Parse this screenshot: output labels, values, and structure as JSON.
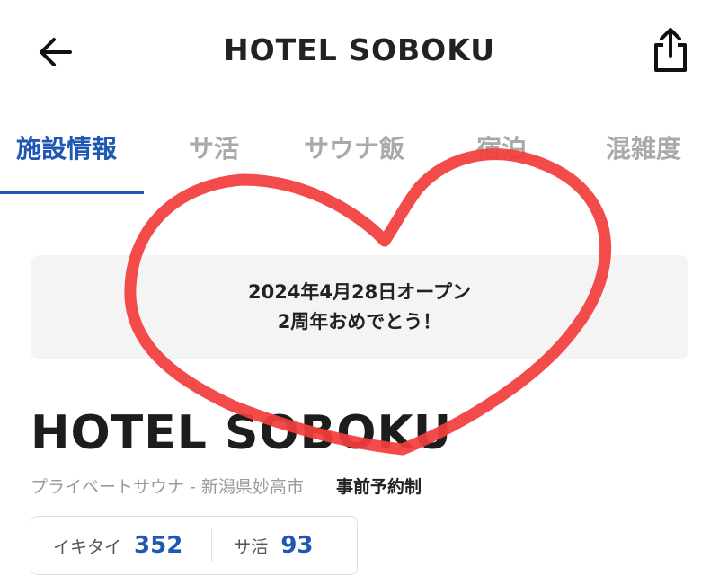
{
  "header": {
    "back_icon": "arrow-left-icon",
    "title": "HOTEL SOBOKU",
    "share_icon": "share-icon"
  },
  "tabs": [
    {
      "label": "施設情報",
      "active": true
    },
    {
      "label": "サ活",
      "active": false
    },
    {
      "label": "サウナ飯",
      "active": false
    },
    {
      "label": "宿泊",
      "active": false
    },
    {
      "label": "混雑度",
      "active": false
    }
  ],
  "notice": {
    "line1": "2024年4月28日オープン",
    "line2": "2周年おめでとう！"
  },
  "facility": {
    "name": "HOTEL SOBOKU",
    "category": "プライベートサウナ - 新潟県妙高市",
    "reservation": "事前予約制"
  },
  "stats": [
    {
      "label": "イキタイ",
      "value": "352"
    },
    {
      "label": "サ活",
      "value": "93"
    }
  ],
  "colors": {
    "accent": "#1f57b5",
    "heart_overlay": "#f23c3c",
    "inactive_tab": "#a9a9a9"
  }
}
